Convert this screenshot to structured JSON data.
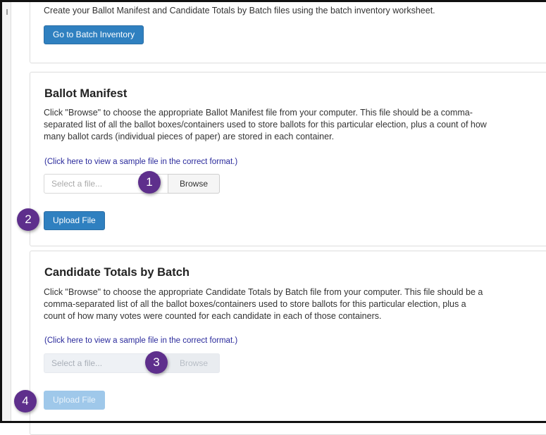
{
  "intro": {
    "text": "Create your Ballot Manifest and Candidate Totals by Batch files using the batch inventory worksheet.",
    "button_label": "Go to Batch Inventory"
  },
  "ballot_manifest": {
    "title": "Ballot Manifest",
    "description_lines": [
      "Click \"Browse\" to choose the appropriate Ballot Manifest file from your computer. This file should be a comma-",
      "separated list of all the ballot boxes/containers used to store ballots for this particular election, plus a count of how",
      "many ballot cards (individual pieces of paper) are stored in each container."
    ],
    "sample_link": "(Click here to view a sample file in the correct format.)",
    "file_placeholder": "Select a file...",
    "browse_label": "Browse",
    "upload_label": "Upload File"
  },
  "candidate_totals": {
    "title": "Candidate Totals by Batch",
    "description_lines": [
      "Click \"Browse\" to choose the appropriate Candidate Totals by Batch file from your computer. This file should be a",
      "comma-separated list of all the ballot boxes/containers used to store ballots for this particular election, plus a",
      "count of how many votes were counted for each candidate in each of those containers."
    ],
    "sample_link": "(Click here to view a sample file in the correct format.)",
    "file_placeholder": "Select a file...",
    "browse_label": "Browse",
    "upload_label": "Upload File"
  },
  "steps": [
    "1",
    "2",
    "3",
    "4"
  ],
  "colors": {
    "primary_button": "#2f80c0",
    "disabled_button": "#9fc8ea",
    "step_badge": "#5e2f8c",
    "link": "#2a2a9c"
  }
}
